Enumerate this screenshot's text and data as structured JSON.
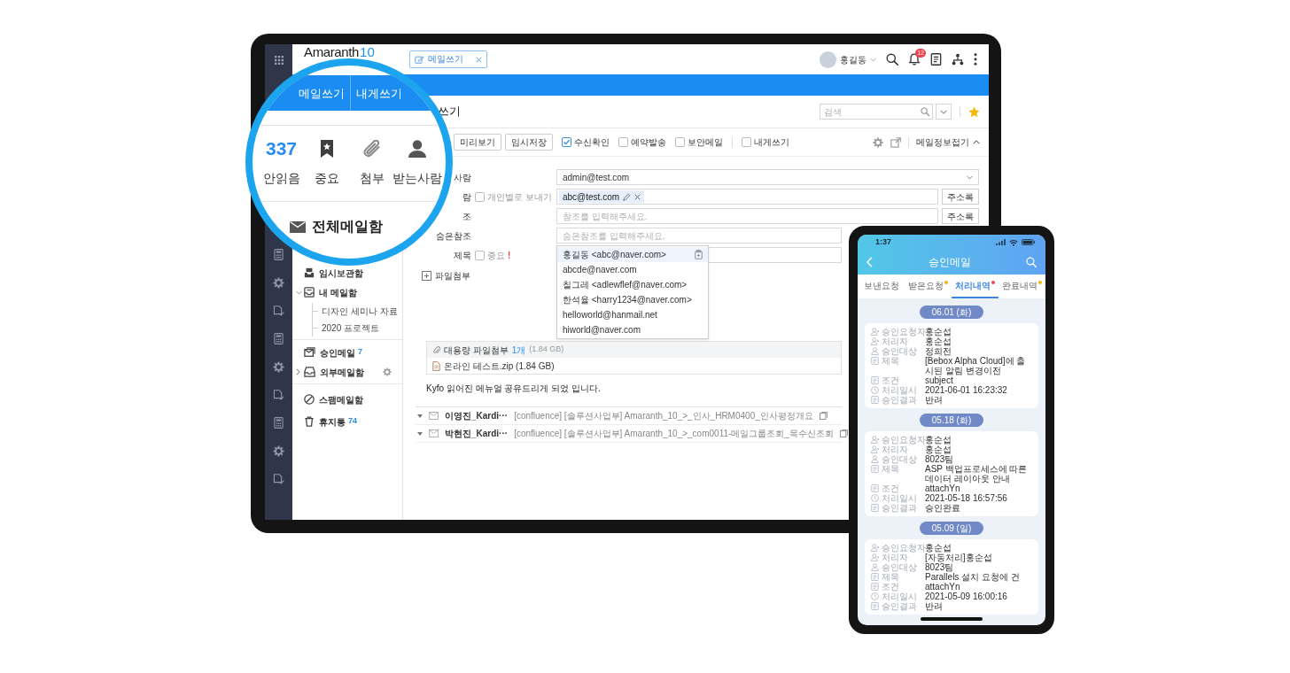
{
  "tablet": {
    "header": {
      "logo": "Amaranth",
      "logo_version": "10",
      "open_tab": "메일쓰기",
      "user": "홍길동",
      "notification_count": "12"
    },
    "magnifier": {
      "tabs": [
        "메일쓰기",
        "내게쓰기"
      ],
      "stats": [
        {
          "kind": "count",
          "value": "337",
          "label": "안읽음"
        },
        {
          "kind": "bookmark",
          "label": "중요"
        },
        {
          "kind": "clip",
          "label": "첨부"
        },
        {
          "kind": "person",
          "label": "받는사람"
        }
      ],
      "mailbox": "전체메일함"
    },
    "sidebar": {
      "groups": [
        [
          {
            "kind": "drafts",
            "label": "임시보관함"
          },
          {
            "kind": "mybox",
            "label": "내 메일함",
            "expanded": true,
            "children": [
              {
                "label": "디자인 세미나 자료"
              },
              {
                "label": "2020 프로젝트"
              }
            ]
          }
        ],
        [
          {
            "kind": "approval",
            "label": "승인메일",
            "count": "7"
          },
          {
            "kind": "external",
            "label": "외부메일함",
            "expanded": false
          }
        ],
        [
          {
            "kind": "spam",
            "label": "스팸메일함"
          },
          {
            "kind": "trash",
            "label": "휴지통",
            "count": "74"
          }
        ]
      ]
    },
    "compose": {
      "title": "쓰기",
      "search": {
        "placeholder": "검색"
      },
      "toolbar": {
        "buttons": [
          "미리보기",
          "임시저장"
        ],
        "options": [
          {
            "label": "수신확인",
            "checked": true
          },
          {
            "label": "예약발송",
            "checked": false
          },
          {
            "label": "보안메일",
            "checked": false
          }
        ],
        "self_send": {
          "label": "내게쓰기",
          "checked": false
        },
        "collapse": "메일정보접기"
      },
      "fields": [
        {
          "kind": "select",
          "label": "사람",
          "value": "admin@test.com"
        },
        {
          "kind": "chips",
          "label": "람",
          "option": {
            "label": "개인별로 보내기",
            "checked": false
          },
          "chips": [
            "abc@test.com"
          ],
          "button": "주소록"
        },
        {
          "kind": "text",
          "label": "조",
          "placeholder": "참조를 입력해주세요.",
          "button": "주소록"
        },
        {
          "kind": "text",
          "label": "숨은참조",
          "placeholder": "숨은참조를 입력해주세요.",
          "suggestions": [
            {
              "text": "홍길동 <abc@naver.com>",
              "selected": true
            },
            {
              "text": "abcde@naver.com",
              "selected": false
            },
            {
              "text": "칠그레 <adlewflef@naver.com>",
              "selected": false
            },
            {
              "text": "한석율 <harry1234@naver.com>",
              "selected": false
            },
            {
              "text": "helloworld@hanmail.net",
              "selected": false
            },
            {
              "text": "hiworld@naver.com",
              "selected": false
            }
          ]
        },
        {
          "kind": "text",
          "label": "제목",
          "option": {
            "label": "중요",
            "checked": false,
            "mark": "!"
          }
        }
      ],
      "attachment": {
        "label": "파일첨부",
        "title": "대용량 파일첨부",
        "count": "1개",
        "size": "(1.84 GB)",
        "file": "온라인 테스트.zip (1.84 GB)"
      },
      "body": "Kyfo 읽어진 메뉴얼 공유드리게 되었 입니다.",
      "mails": [
        {
          "sender": "이영진_Kardi···",
          "subject": "[confluence] [솔루션사업부] Amaranth_10_>_인사_HRM0400_인사평정개요"
        },
        {
          "sender": "박현진_Kardi···",
          "subject": "[confluence] [솔루션사업부] Amaranth_10_>_com0011-메일그룹조회_목수신조회"
        }
      ]
    }
  },
  "phone": {
    "time": "1:37",
    "title": "승인메일",
    "tabs": [
      {
        "label": "보낸요청",
        "selected": false
      },
      {
        "label": "받은요청",
        "selected": false,
        "color": "#f7b500"
      },
      {
        "label": "처리내역",
        "selected": true,
        "color": "#f0424c"
      },
      {
        "label": "완료내역",
        "selected": false,
        "color": "#f7b500"
      }
    ],
    "sections": [
      {
        "date": "06.01 (화)",
        "rows": [
          {
            "kind": "requester",
            "label": "승인요청자",
            "value": "홍순섭"
          },
          {
            "kind": "handler",
            "label": "처리자",
            "value": "홍순섭"
          },
          {
            "kind": "target",
            "label": "승인대상",
            "value": "정희전"
          },
          {
            "kind": "subject",
            "label": "제목",
            "value": "[Bebox Alpha Cloud]에 출시된 알림 변경이전"
          },
          {
            "kind": "condition",
            "label": "조건",
            "value": "subject"
          },
          {
            "kind": "time",
            "label": "처리일시",
            "value": "2021-06-01 16:23:32"
          },
          {
            "kind": "result",
            "label": "승인결과",
            "value": "반려"
          }
        ]
      },
      {
        "date": "05.18 (화)",
        "rows": [
          {
            "kind": "requester",
            "label": "승인요청자",
            "value": "홍순섭"
          },
          {
            "kind": "handler",
            "label": "처리자",
            "value": "홍순섭"
          },
          {
            "kind": "target",
            "label": "승인대상",
            "value": "8023팀"
          },
          {
            "kind": "subject",
            "label": "제목",
            "value": "ASP 백업프로세스에 따른 데이터 레이아웃 안내"
          },
          {
            "kind": "condition",
            "label": "조건",
            "value": "attachYn"
          },
          {
            "kind": "time",
            "label": "처리일시",
            "value": "2021-05-18 16:57:56"
          },
          {
            "kind": "result",
            "label": "승인결과",
            "value": "승인완료"
          }
        ]
      },
      {
        "date": "05.09 (일)",
        "rows": [
          {
            "kind": "requester",
            "label": "승인요청자",
            "value": "홍순섭"
          },
          {
            "kind": "handler",
            "label": "처리자",
            "value": "[자동처리]홍순섭"
          },
          {
            "kind": "target",
            "label": "승인대상",
            "value": "8023팀"
          },
          {
            "kind": "subject",
            "label": "제목",
            "value": "Parallels 설치 요청에 건"
          },
          {
            "kind": "condition",
            "label": "조건",
            "value": "attachYn"
          },
          {
            "kind": "time",
            "label": "처리일시",
            "value": "2021-05-09 16:00:16"
          },
          {
            "kind": "result",
            "label": "승인결과",
            "value": "반려"
          }
        ]
      }
    ]
  }
}
